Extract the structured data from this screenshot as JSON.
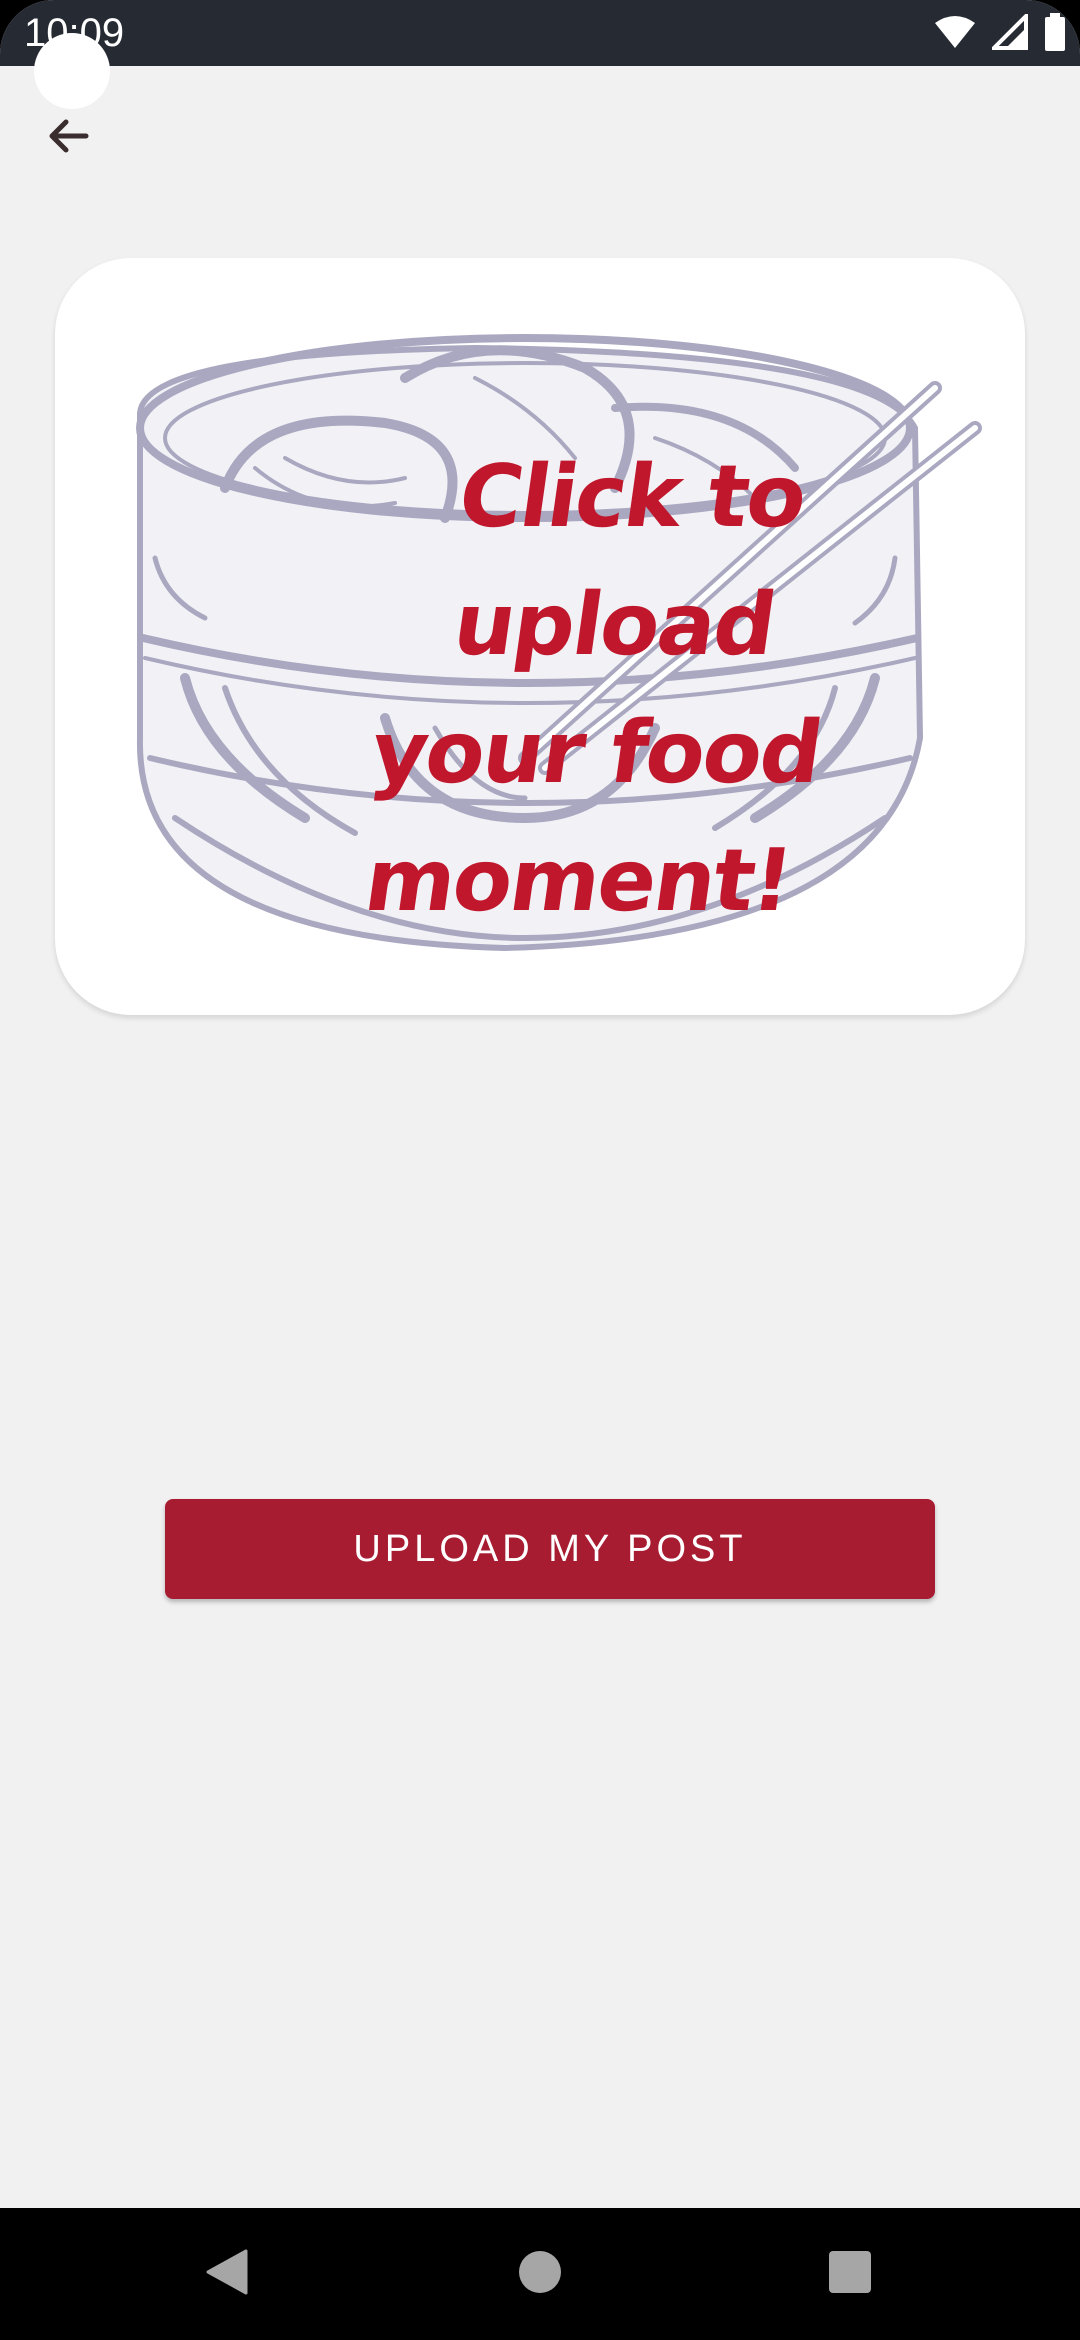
{
  "status_bar": {
    "time": "10:09",
    "icons": [
      "wifi-icon",
      "cellular-signal-icon",
      "battery-icon"
    ]
  },
  "toolbar": {
    "back_icon": "arrow-left-icon"
  },
  "upload_card": {
    "prompt_lines": [
      "Click to",
      "upload",
      "your food",
      "moment!"
    ],
    "illustration": "bamboo-steamer-with-chopsticks"
  },
  "actions": {
    "upload_label": "UPLOAD MY POST"
  },
  "nav_bar": {
    "icons": [
      "back-triangle-icon",
      "home-circle-icon",
      "recents-square-icon"
    ]
  },
  "colors": {
    "status_bar": "#262b33",
    "background": "#f2f1f2",
    "accent": "#a81c31",
    "prompt_text": "#c1172c",
    "illustration": "#a9a8c0"
  }
}
